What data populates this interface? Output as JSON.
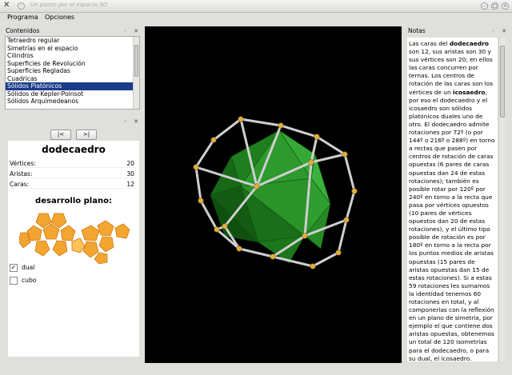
{
  "window": {
    "title": "Un paseo por el espacio 3D"
  },
  "menu": [
    "Programa",
    "Opciones"
  ],
  "panels": {
    "contenidos": "Contenidos",
    "notas": "Notas",
    "float_icon": "◦",
    "close_icon": "✕"
  },
  "contents_list": {
    "items": [
      "Tetraedro regular",
      "Simetrías en el espacio",
      "Cilindros",
      "Superficies de Revolución",
      "Superficies Regladas",
      "Cuadricas",
      "Sólidos Platónicos",
      "Sólidos de Kepler-Poinsot",
      "Sólidos Arquimedeanos"
    ],
    "selected_index": 6
  },
  "nav": {
    "prev": "|<",
    "next": ">|"
  },
  "info": {
    "title": "dodecaedro",
    "properties": [
      {
        "label": "Vértices:",
        "value": "20"
      },
      {
        "label": "Aristas:",
        "value": "30"
      },
      {
        "label": "Caras:",
        "value": "12"
      }
    ],
    "desarrollo_label": "desarrollo plano:",
    "options": [
      {
        "label": "dual",
        "checked": true
      },
      {
        "label": "cubo",
        "checked": false
      }
    ]
  },
  "notes_parts": [
    [
      "Las caras del ",
      false
    ],
    [
      "dodecaedro",
      true
    ],
    [
      " son 12, sus aristas son 30 y sus vértices son 20; en ellos las caras concurren por ternas. Los centros de rotación de las caras son los vértices de un ",
      false
    ],
    [
      "icosaedro",
      true
    ],
    [
      ", por eso el dodecaedro y el icosaedro son sólidos platónicos duales uno de otro. El dodecaedro admite rotaciones por 72º (o por 144º o 216º o 288º) en torno a rectas que pasen por centros de rotación de caras opuestas (6 pares de caras opuestas dan 24 de estas rotaciones); también es posible rotar por 120º por 240º en torno a la recta que pasa por vértices opuestos (10 pares de vértices opuestos dan 20 de estas rotaciones), y el último tipo posible de rotación es por 180º en torno a la recta por los puntos medios de aristas opuestas (15 pares de aristas opuestas dan 15 de estas rotaciones). Si a estas 59 rotaciones les sumamos la identidad tenemos 60 rotaciones en total, y al componerlas con la reflexión en un plano de simetría, por ejemplo el que contiene dos aristas opuestas, obtenemos un total de 120 isometrías para el dodecaedro, o para su dual, el icosaedro.",
      false
    ]
  ],
  "colors": {
    "viewport_bg": "#000000",
    "selection": "#1a3c8a",
    "icosa_green": "#1f8a1f",
    "net_orange": "#f2a531"
  }
}
